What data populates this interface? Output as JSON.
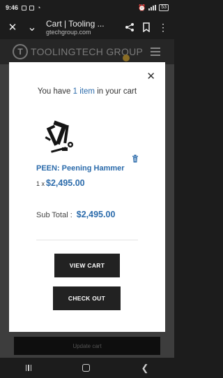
{
  "status_bar": {
    "time": "9:46",
    "battery": "53"
  },
  "browser": {
    "title": "Cart | Tooling ...",
    "url": "gtechgroup.com"
  },
  "site": {
    "logo_text": "TOOLINGTECH GROUP",
    "logo_mark": "T",
    "background_button_label": "Update cart"
  },
  "cart_popup": {
    "heading_prefix": "You have",
    "item_count": "1 item",
    "heading_suffix": "in your cart",
    "product": {
      "name": "PEEN: Peening Hammer",
      "quantity": "1 x",
      "price": "$2,495.00"
    },
    "subtotal_label": "Sub Total :",
    "subtotal_value": "$2,495.00",
    "view_cart_label": "VIEW CART",
    "checkout_label": "CHECK OUT"
  },
  "colors": {
    "accent": "#2b6bab",
    "button_bg": "#222222"
  }
}
